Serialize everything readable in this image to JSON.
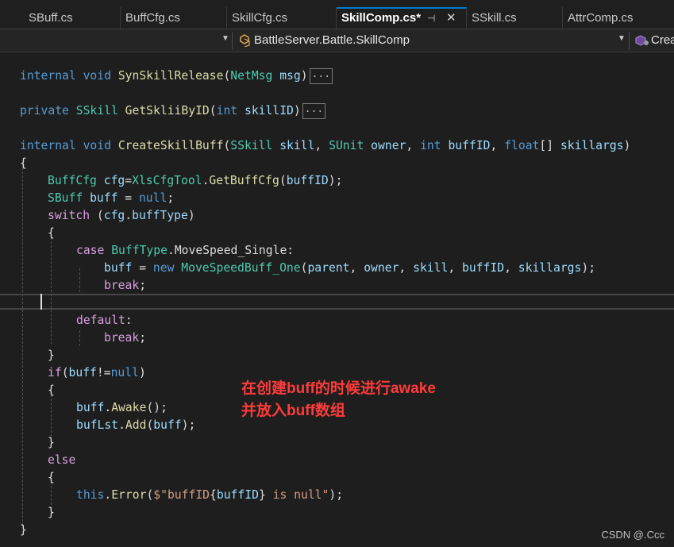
{
  "tabs": [
    {
      "label": "SBuff.cs"
    },
    {
      "label": "BuffCfg.cs"
    },
    {
      "label": "SkillCfg.cs"
    },
    {
      "label": "SkillComp.cs*",
      "active": true
    },
    {
      "label": "SSkill.cs"
    },
    {
      "label": "AttrComp.cs"
    }
  ],
  "tab_icons": {
    "pin": "pin-icon",
    "close": "close-icon"
  },
  "navbar": {
    "member_path": "BattleServer.Battle.SkillComp",
    "member_icon": "class-icon",
    "right_item": "Crea",
    "right_icon": "method-cube-icon"
  },
  "code": {
    "fold_marker": "...",
    "l1": {
      "mod": "internal",
      "ret": "void",
      "name": "SynSkillRelease",
      "p1": "(",
      "ptype": "NetMsg",
      "pname": "msg",
      "p2": ")"
    },
    "l2": {
      "mod": "private",
      "ret": "SSkill",
      "name": "GetSkliiByID",
      "p1": "(",
      "ptype": "int",
      "pname": "skillID",
      "p2": ")"
    },
    "l3": {
      "mod": "internal",
      "ret": "void",
      "name": "CreateSkillBuff",
      "t1": "SSkill",
      "n1": "skill",
      "t2": "SUnit",
      "n2": "owner",
      "t3": "int",
      "n3": "buffID",
      "t4": "float",
      "n4": "skillargs"
    },
    "l5": {
      "type": "BuffCfg",
      "var": "cfg",
      "cls": "XlsCfgTool",
      "fn": "GetBuffCfg",
      "arg": "buffID"
    },
    "l6": {
      "type": "SBuff",
      "var": "buff",
      "val": "null"
    },
    "l7": {
      "kw": "switch",
      "obj": "cfg",
      "prop": "buffType"
    },
    "l9": {
      "kw": "case",
      "enum": "BuffType",
      "member": "MoveSpeed_Single"
    },
    "l10": {
      "var": "buff",
      "kw": "new",
      "type": "MoveSpeedBuff_One",
      "a1": "parent",
      "a2": "owner",
      "a3": "skill",
      "a4": "buffID",
      "a5": "skillargs"
    },
    "l11": {
      "kw": "break"
    },
    "l13": {
      "kw": "default"
    },
    "l14": {
      "kw": "break"
    },
    "l16": {
      "kw": "if",
      "var": "buff",
      "op": "!=",
      "val": "null"
    },
    "l18": {
      "var": "buff",
      "fn": "Awake"
    },
    "l19": {
      "var": "bufLst",
      "fn": "Add",
      "arg": "buff"
    },
    "l21": {
      "kw": "else"
    },
    "l23": {
      "kw": "this",
      "fn": "Error",
      "s1": "$\"buffID",
      "arg": "buffID",
      "s2": " is null\""
    }
  },
  "annotation": {
    "line1": "在创建buff的时候进行awake",
    "line2": "并放入buff数组",
    "color": "#ff3b3b"
  },
  "watermark": "CSDN @.Ccc",
  "colors": {
    "keyword": "#569cd6",
    "type": "#4ec9b0",
    "method": "#dcdcaa",
    "variable": "#9cdcfe",
    "control": "#d8a0df",
    "string": "#d69d85",
    "background": "#1e1e1e"
  }
}
